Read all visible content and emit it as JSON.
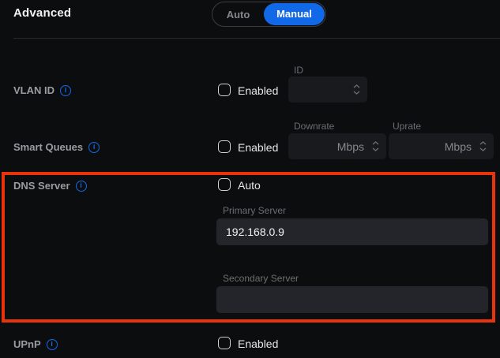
{
  "colors": {
    "accent_blue": "#1269e8",
    "annotation_red": "#e8330c",
    "background": "#0c0d0f"
  },
  "header": {
    "title": "Advanced",
    "toggle": {
      "options": [
        "Auto",
        "Manual"
      ],
      "selected": "Manual"
    }
  },
  "rows": {
    "vlan": {
      "label": "VLAN ID",
      "checkbox_label": "Enabled",
      "checked": false,
      "field": {
        "label": "ID",
        "value": ""
      }
    },
    "smart_queues": {
      "label": "Smart Queues",
      "checkbox_label": "Enabled",
      "checked": false,
      "fields": [
        {
          "label": "Downrate",
          "value": "",
          "unit": "Mbps"
        },
        {
          "label": "Uprate",
          "value": "",
          "unit": "Mbps"
        }
      ]
    },
    "dns": {
      "label": "DNS Server",
      "checkbox_label": "Auto",
      "checked": false,
      "fields": [
        {
          "label": "Primary Server",
          "value": "192.168.0.9"
        },
        {
          "label": "Secondary Server",
          "value": ""
        }
      ]
    },
    "upnp": {
      "label": "UPnP",
      "checkbox_label": "Enabled",
      "checked": false
    }
  },
  "icons": {
    "info": "i"
  }
}
